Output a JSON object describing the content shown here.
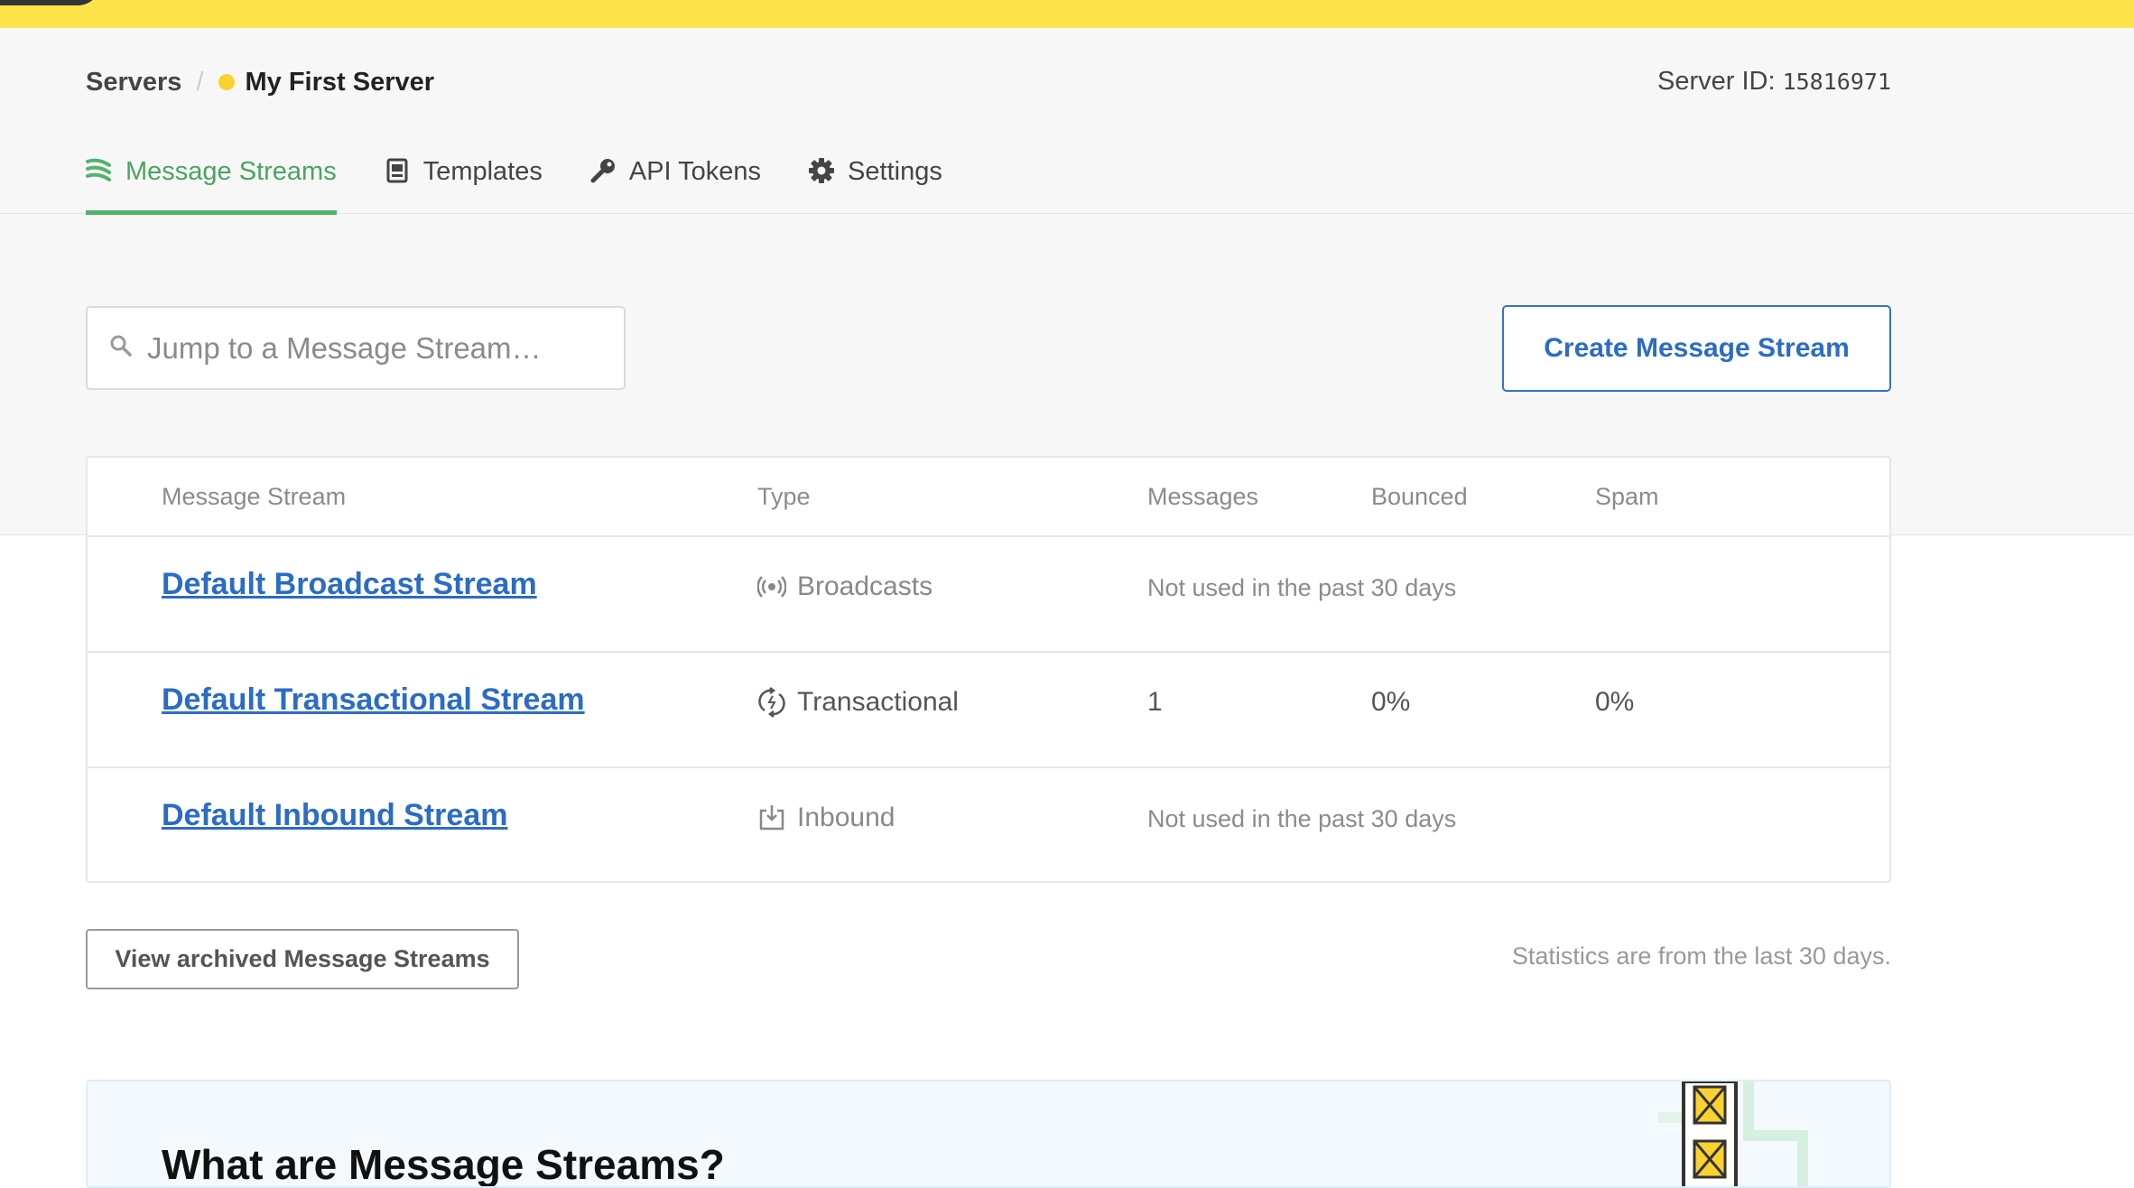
{
  "breadcrumb": {
    "root": "Servers",
    "separator": "/",
    "current": "My First Server"
  },
  "server": {
    "id_label": "Server ID:",
    "id_value": "15816971",
    "status_color": "#f9d230"
  },
  "tabs": [
    {
      "label": "Message Streams",
      "icon": "streams-icon",
      "active": true
    },
    {
      "label": "Templates",
      "icon": "template-icon",
      "active": false
    },
    {
      "label": "API Tokens",
      "icon": "key-icon",
      "active": false
    },
    {
      "label": "Settings",
      "icon": "gear-icon",
      "active": false
    }
  ],
  "search": {
    "placeholder": "Jump to a Message Stream…",
    "value": ""
  },
  "actions": {
    "create_label": "Create Message Stream",
    "archived_label": "View archived Message Streams"
  },
  "table": {
    "headers": {
      "stream": "Message Stream",
      "type": "Type",
      "messages": "Messages",
      "bounced": "Bounced",
      "spam": "Spam"
    },
    "rows": [
      {
        "name": "Default Broadcast Stream",
        "type": "Broadcasts",
        "type_icon": "broadcast-icon",
        "note": "Not used in the past 30 days"
      },
      {
        "name": "Default Transactional Stream",
        "type": "Transactional",
        "type_icon": "transactional-icon",
        "messages": "1",
        "bounced": "0%",
        "spam": "0%"
      },
      {
        "name": "Default Inbound Stream",
        "type": "Inbound",
        "type_icon": "inbound-icon",
        "note": "Not used in the past 30 days"
      }
    ]
  },
  "stats_note": "Statistics are from the last 30 days.",
  "info": {
    "title": "What are Message Streams?"
  },
  "colors": {
    "brand_yellow": "#fde24a",
    "active_green": "#52b36a",
    "link_blue": "#2b6cc4"
  }
}
